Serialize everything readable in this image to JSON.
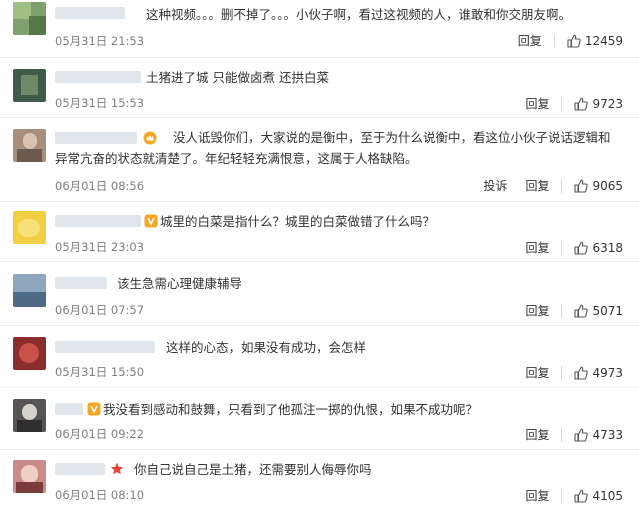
{
  "comments": [
    {
      "text": "这种视频。。。删不掉了。。。小伙子啊，看过这视频的人，谁敢和你交朋友啊。",
      "time": "05月31日 21:53",
      "reply": "回复",
      "likes": "12459",
      "report": ""
    },
    {
      "text": "土猪进了城 只能做卤煮 还拱白菜",
      "time": "05月31日 15:53",
      "reply": "回复",
      "likes": "9723",
      "report": ""
    },
    {
      "text": "没人诋毁你们，大家说的是衡中，至于为什么说衡中，看这位小伙子说话逻辑和异常亢奋的状态就清楚了。年纪轻轻充满恨意，这属于人格缺陷。",
      "time": "06月01日 08:56",
      "reply": "回复",
      "likes": "9065",
      "report": "投诉"
    },
    {
      "text": "城里的白菜是指什么？城里的白菜做错了什么吗？",
      "time": "05月31日 23:03",
      "reply": "回复",
      "likes": "6318",
      "report": ""
    },
    {
      "text": "该生急需心理健康辅导",
      "time": "06月01日 07:57",
      "reply": "回复",
      "likes": "5071",
      "report": ""
    },
    {
      "text": "这样的心态，如果没有成功，会怎样",
      "time": "05月31日 15:50",
      "reply": "回复",
      "likes": "4973",
      "report": ""
    },
    {
      "text": "我没看到感动和鼓舞，只看到了他孤注一掷的仇恨，如果不成功呢？",
      "time": "06月01日 09:22",
      "reply": "回复",
      "likes": "4733",
      "report": ""
    },
    {
      "text": "你自己说自己是土猪，还需要别人侮辱你吗",
      "time": "06月01日 08:10",
      "reply": "回复",
      "likes": "4105",
      "report": ""
    }
  ],
  "icons": {
    "like": "thumbs-up-icon",
    "badge": "crown-badge-icon",
    "vip": "vip-badge-icon",
    "star": "star-badge-icon"
  },
  "colors": {
    "text": "#333333",
    "meta": "#808080",
    "badge": "#f5a623",
    "star": "#e8453c",
    "name_blur": "#dde2ea"
  }
}
